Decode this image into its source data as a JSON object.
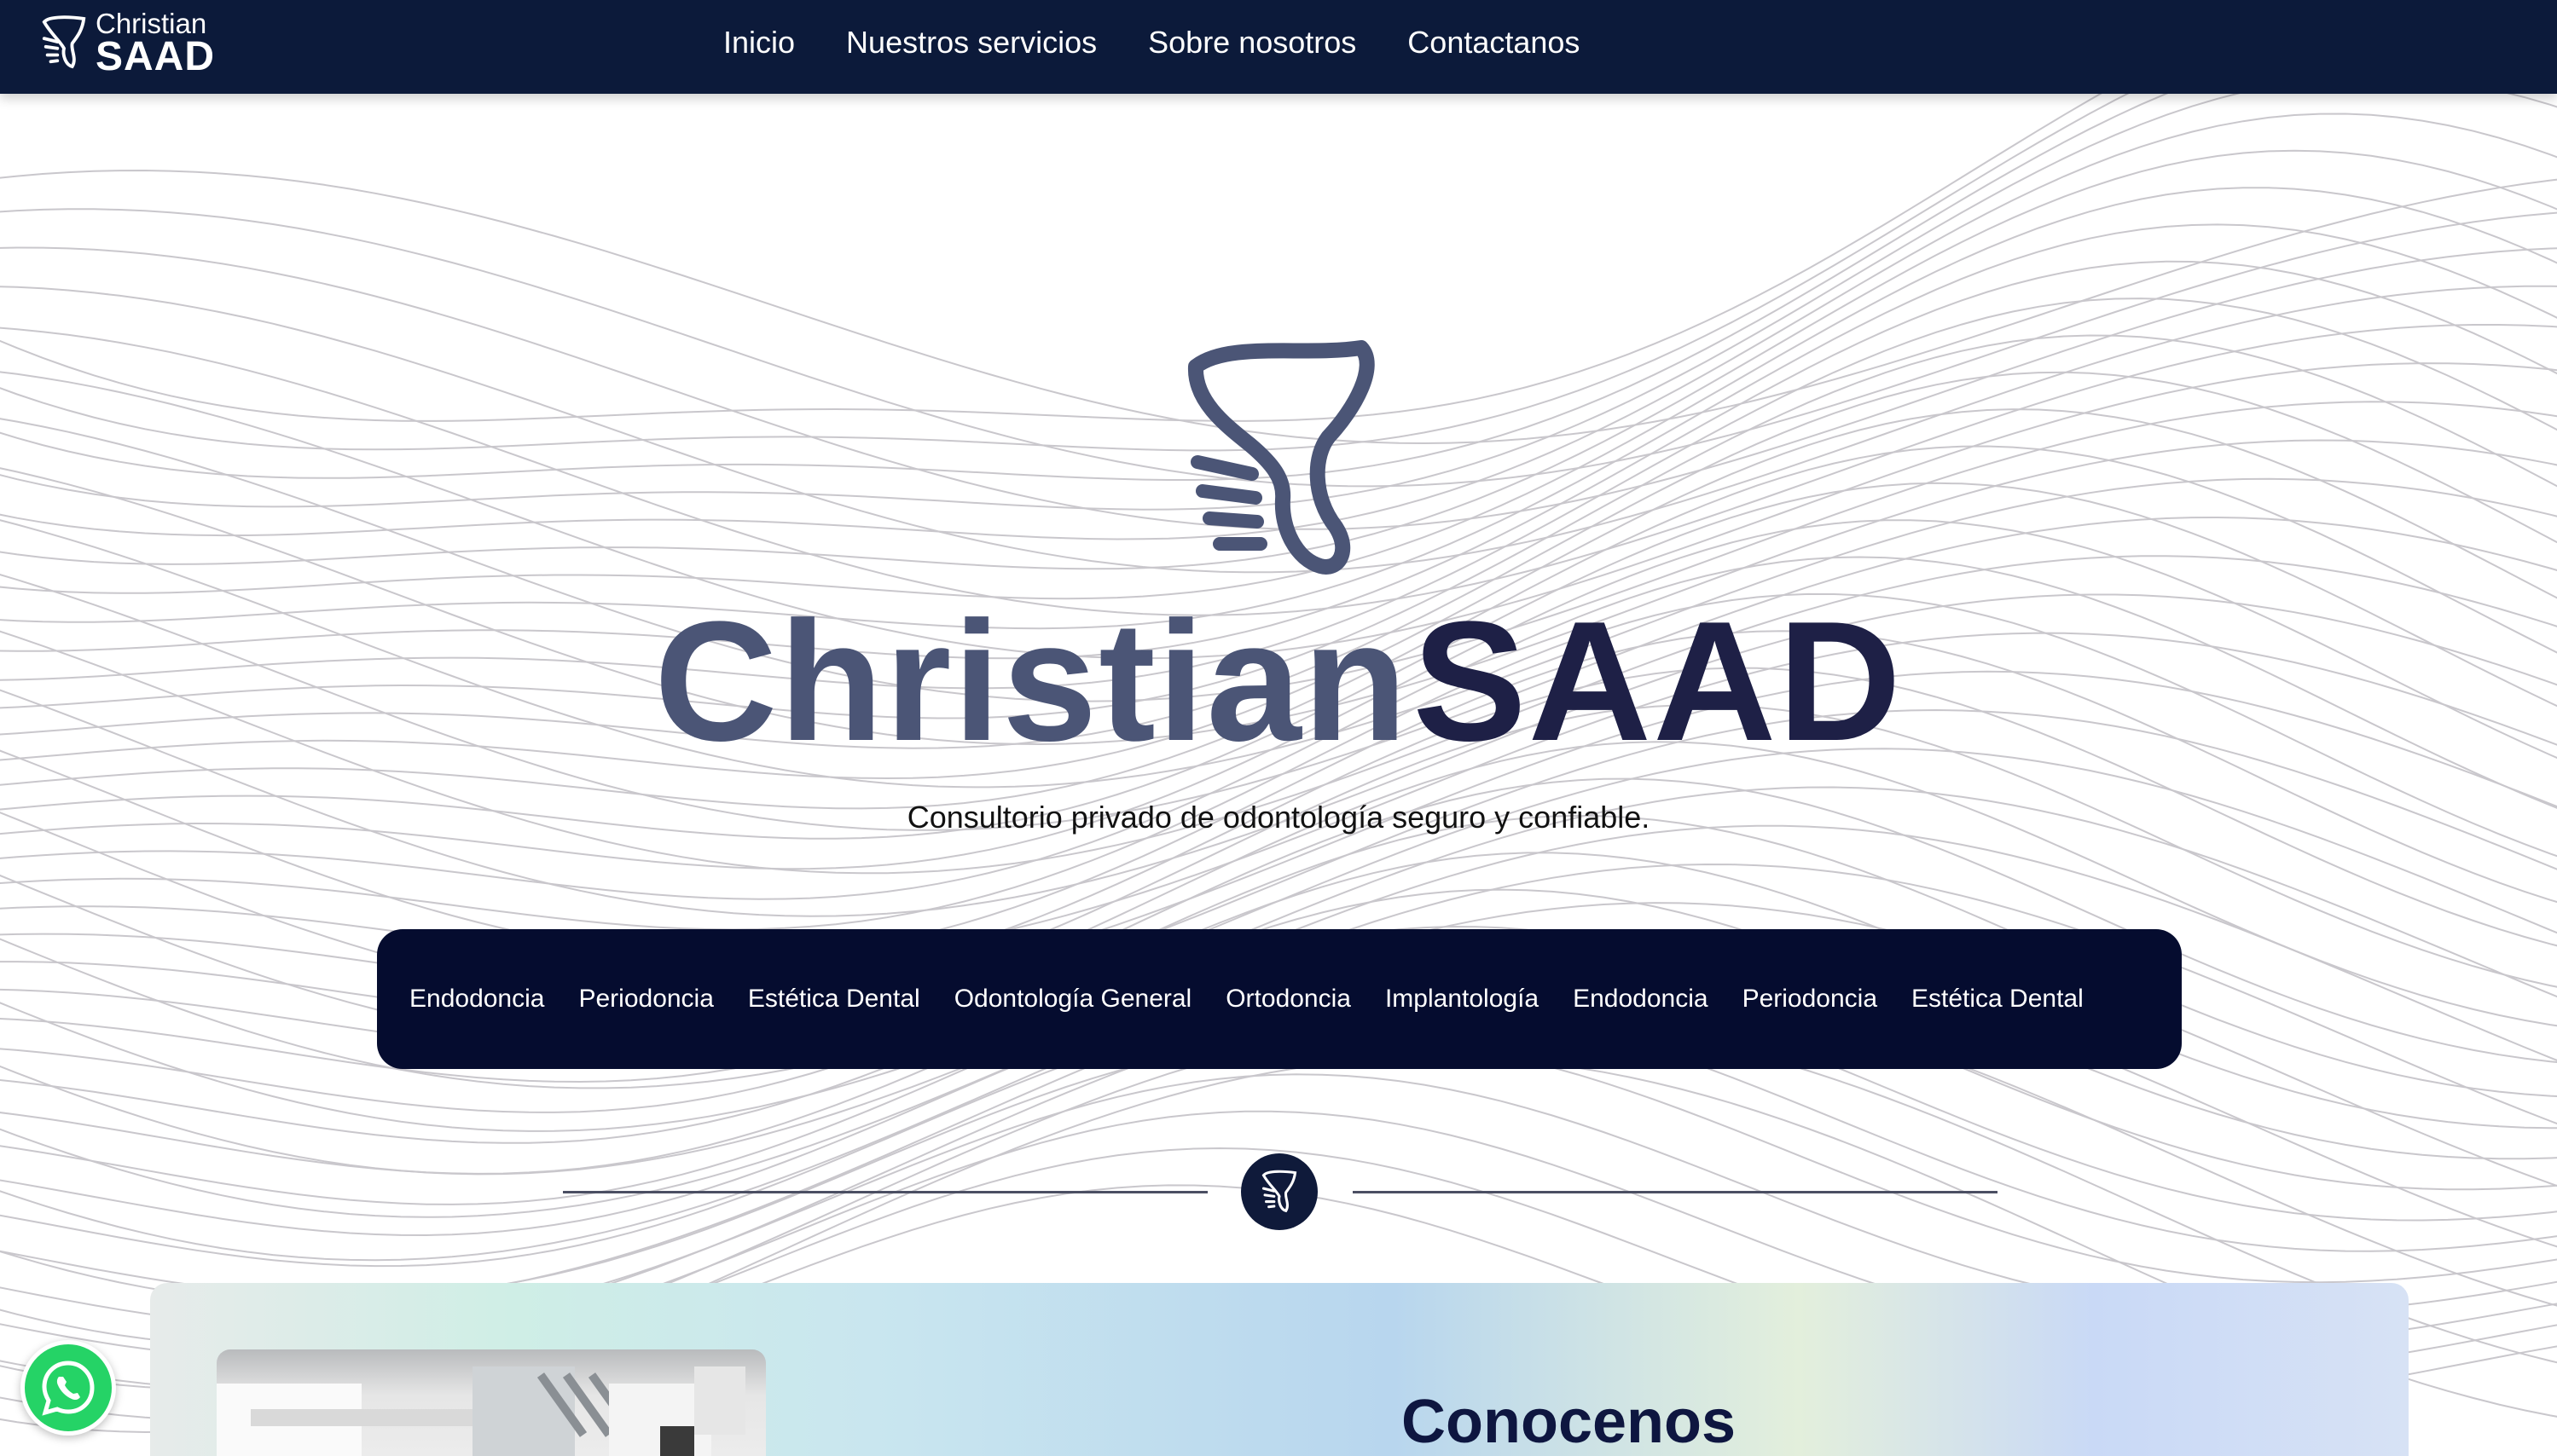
{
  "brand": {
    "name_first": "Christian",
    "name_last": "SAAD",
    "nav_color": "#0c1a3a",
    "accent_dark": "#050c2f",
    "title_gray": "#4b5576",
    "title_navy": "#1e2046"
  },
  "nav": {
    "links": [
      {
        "label": "Inicio"
      },
      {
        "label": "Nuestros servicios"
      },
      {
        "label": "Sobre nosotros"
      },
      {
        "label": "Contactanos"
      }
    ]
  },
  "hero": {
    "title_first": "Christian",
    "title_last": "SAAD",
    "subtitle": "Consultorio privado de odontología seguro y confiable."
  },
  "services": {
    "items": [
      "Endodoncia",
      "Periodoncia",
      "Estética Dental",
      "Odontología General",
      "Ortodoncia",
      "Implantología",
      "Endodoncia",
      "Periodoncia",
      "Estética Dental"
    ]
  },
  "about": {
    "title": "Conocenos"
  },
  "icons": {
    "logo": "tooth-logo-icon",
    "divider": "tooth-badge-icon",
    "whatsapp": "whatsapp-icon"
  }
}
